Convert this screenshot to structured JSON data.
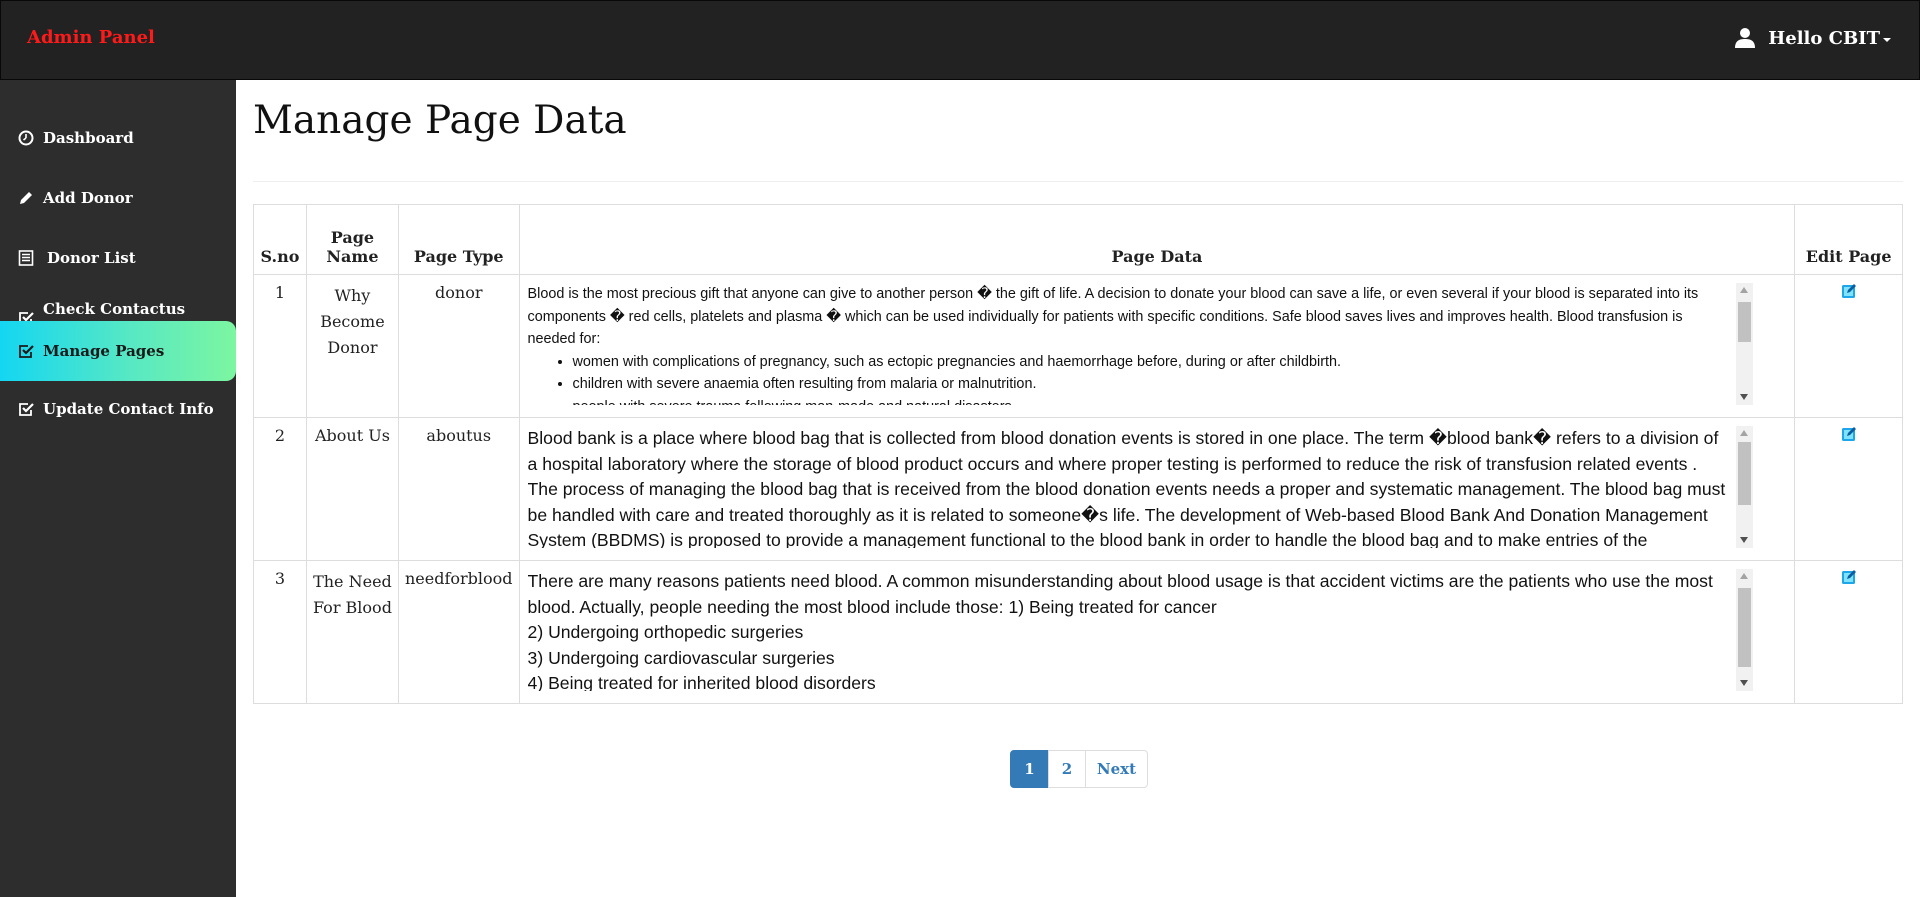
{
  "app": {
    "brand": "Admin Panel",
    "user_greeting": "Hello CBIT"
  },
  "sidebar": {
    "items": [
      {
        "label": "Dashboard",
        "icon": "dashboard-icon"
      },
      {
        "label": "Add Donor",
        "icon": "pencil-icon"
      },
      {
        "label": "Donor List",
        "icon": "list-icon"
      },
      {
        "label": "Check Contactus Query",
        "icon": "check-square-icon"
      },
      {
        "label": "Manage Pages",
        "icon": "check-square-icon",
        "active": true
      },
      {
        "label": "Update Contact Info",
        "icon": "check-square-icon"
      }
    ]
  },
  "main": {
    "title": "Manage Page Data",
    "table": {
      "headers": [
        "S.no",
        "Page Name",
        "Page Type",
        "Page Data",
        "Edit Page"
      ],
      "rows": [
        {
          "sno": "1",
          "name": "Why Become Donor",
          "type": "donor",
          "data_intro": "Blood is the most precious gift that anyone can give to another person � the gift of life. A decision to donate your blood can save a life, or even several if your blood is separated into its components � red cells, platelets and plasma � which can be used individually for patients with specific conditions. Safe blood saves lives and improves health. Blood transfusion is needed for:",
          "data_list": [
            "women with complications of pregnancy, such as ectopic pregnancies and haemorrhage before, during or after childbirth.",
            "children with severe anaemia often resulting from malaria or malnutrition.",
            "people with severe trauma following man-made and natural disasters."
          ]
        },
        {
          "sno": "2",
          "name": "About Us",
          "type": "aboutus",
          "data_text": "Blood bank is a place where blood bag that is collected from blood donation events is stored in one place. The term �blood bank� refers to a division of a hospital laboratory where the storage of blood product occurs and where proper testing is performed to reduce the risk of transfusion related events . The process of managing the blood bag that is received from the blood donation events needs a proper and systematic management. The blood bag must be handled with care and treated thoroughly as it is related to someone�s life. The development of Web-based Blood Bank And Donation Management System (BBDMS) is proposed to provide a management functional to the blood bank in order to handle the blood bag and to make entries of the individuals"
        },
        {
          "sno": "3",
          "name": "The Need For Blood",
          "type": "needforblood",
          "data_lines": [
            "There are many reasons patients need blood. A common misunderstanding about blood usage is that accident victims are the patients who use the most blood. Actually, people needing the most blood include those: 1) Being treated for cancer",
            "2) Undergoing orthopedic surgeries",
            "3) Undergoing cardiovascular surgeries",
            "4) Being treated for inherited blood disorders"
          ]
        }
      ]
    },
    "pagination": {
      "pages": [
        "1",
        "2"
      ],
      "current": "1",
      "next_label": "Next"
    }
  },
  "colors": {
    "navbar": "#222222",
    "sidebar": "#2d2d2d",
    "brand": "#ff1a1a",
    "link": "#337ab7",
    "active_gradient": [
      "#14d6f2",
      "#7cf6a0"
    ],
    "edit_icon": "#1ea7e8"
  }
}
